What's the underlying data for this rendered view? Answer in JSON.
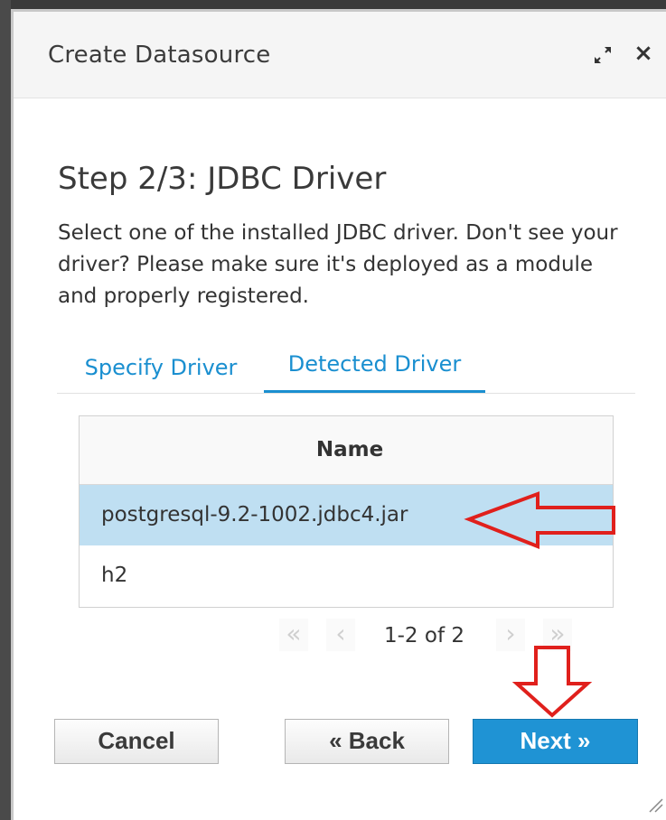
{
  "dialog": {
    "title": "Create Datasource",
    "maximize_icon": "maximize-icon",
    "close_label": "×"
  },
  "step": {
    "title": "Step 2/3: JDBC Driver",
    "description": "Select one of the installed JDBC driver. Don't see your driver? Please make sure it's deployed as a module and properly registered."
  },
  "tabs": [
    {
      "label": "Specify Driver",
      "active": false
    },
    {
      "label": "Detected Driver",
      "active": true
    }
  ],
  "table": {
    "header": "Name",
    "rows": [
      {
        "name": "postgresql-9.2-1002.jdbc4.jar",
        "selected": true
      },
      {
        "name": "h2",
        "selected": false
      }
    ]
  },
  "pager": {
    "first": "«",
    "prev": "‹",
    "info": "1-2 of 2",
    "next": "›",
    "last": "»"
  },
  "buttons": {
    "cancel": "Cancel",
    "back": "« Back",
    "next": "Next »"
  },
  "colors": {
    "accent": "#1a8fd0",
    "selected_row": "#bfdff2",
    "annotation_arrow": "#e0201c"
  }
}
